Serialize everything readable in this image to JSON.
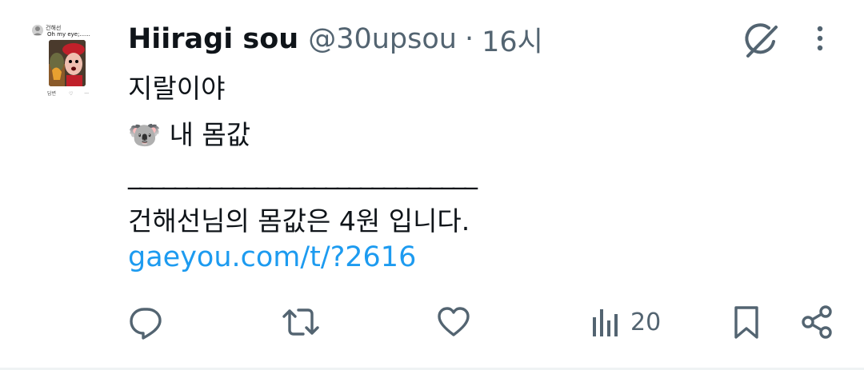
{
  "avatar": {
    "mini_name": "건해선",
    "mini_tweet": "Oh my eye;......",
    "mini_reply_label": "답변"
  },
  "tweet": {
    "display_name": "Hiiragi sou",
    "handle": "@30upsou",
    "separator": "·",
    "time": "16시",
    "lines": [
      "지랄이야",
      "🐨 내 몸값",
      "______________________________",
      "건해선님의 몸값은 4원 입니다."
    ],
    "link": "gaeyou.com/t/?2616",
    "views": "20"
  },
  "icons": {
    "grok": "grok-icon",
    "more": "more-vertical-icon",
    "reply": "reply-icon",
    "retweet": "retweet-icon",
    "like": "heart-icon",
    "views": "analytics-icon",
    "bookmark": "bookmark-icon",
    "share": "share-icon"
  },
  "colors": {
    "text": "#0f1419",
    "secondary": "#536471",
    "link": "#1d9bf0"
  }
}
